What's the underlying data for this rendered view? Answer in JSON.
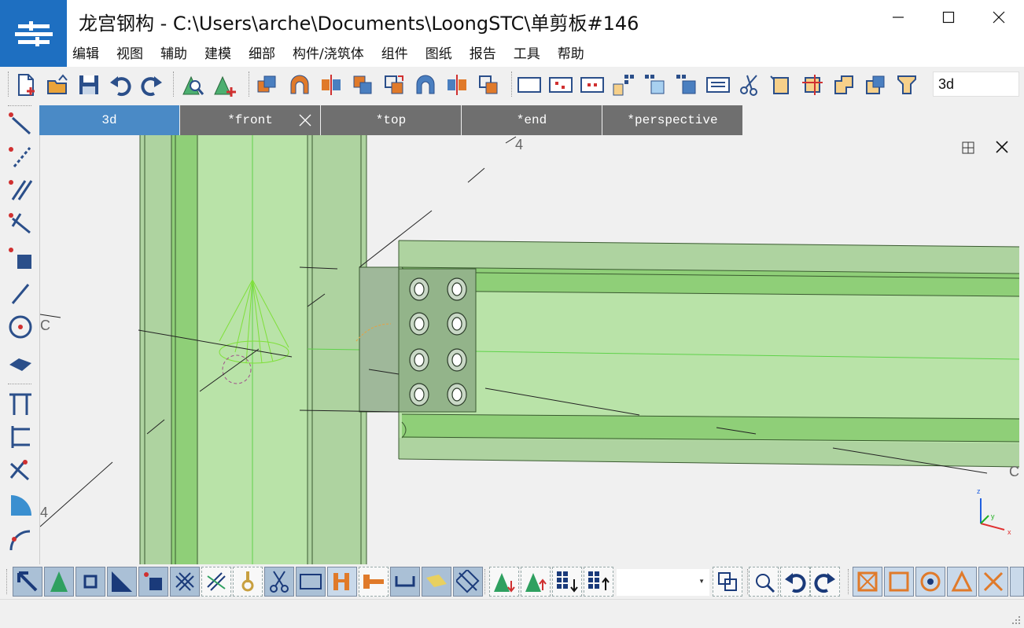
{
  "window": {
    "title": "龙宫钢构 - C:\\Users\\arche\\Documents\\LoongSTC\\单剪板#146",
    "logo_icon": "loongstc-logo-icon",
    "accent": "#1e6fc1"
  },
  "menu": {
    "items": [
      "编辑",
      "视图",
      "辅助",
      "建模",
      "细部",
      "构件/浇筑体",
      "组件",
      "图纸",
      "报告",
      "工具",
      "帮助"
    ]
  },
  "toolbar": {
    "view_name": "3d"
  },
  "tabs": [
    {
      "label": "3d",
      "active": true
    },
    {
      "label": "*front",
      "active": false,
      "closable": true
    },
    {
      "label": "*top",
      "active": false
    },
    {
      "label": "*end",
      "active": false
    },
    {
      "label": "*perspective",
      "active": false
    }
  ],
  "viewport": {
    "grid_labels": {
      "top": "4",
      "left_upper": "C",
      "left_lower": "4",
      "right": "C"
    },
    "axis": {
      "z": "z",
      "y": "y",
      "x": "x"
    },
    "colors": {
      "member": "#8fd07a",
      "member_dark": "#5aa04a",
      "plate": "#9fb89a"
    }
  },
  "bottom_toolbar": {
    "filter_value": ""
  }
}
